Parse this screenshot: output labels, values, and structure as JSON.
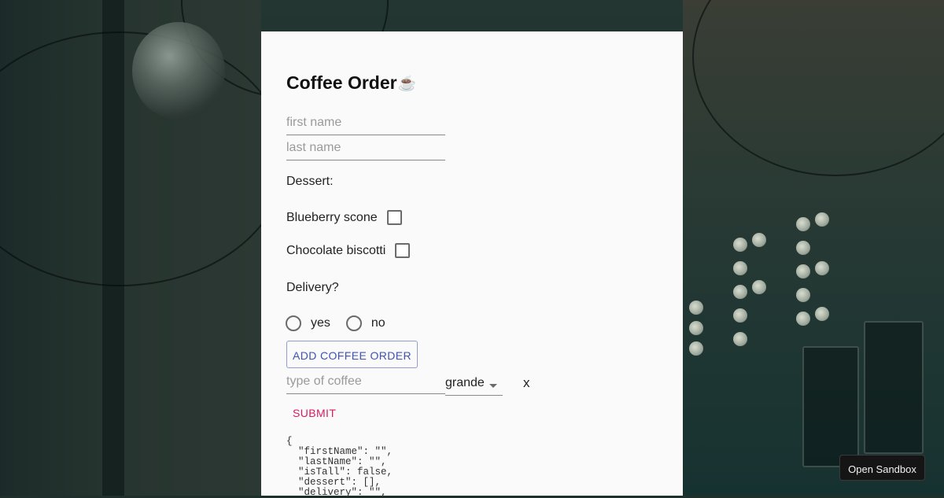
{
  "form": {
    "title": "Coffee Order",
    "title_emoji": "☕",
    "first_name_placeholder": "first name",
    "last_name_placeholder": "last name",
    "dessert_label": "Dessert:",
    "desserts": [
      {
        "label": "Blueberry scone",
        "checked": false
      },
      {
        "label": "Chocolate biscotti",
        "checked": false
      }
    ],
    "delivery_label": "Delivery?",
    "delivery_options": [
      {
        "label": "yes",
        "selected": false
      },
      {
        "label": "no",
        "selected": false
      }
    ],
    "add_button_label": "ADD COFFEE ORDER",
    "coffee_type_placeholder": "type of coffee",
    "size_value": "grande",
    "remove_label": "x",
    "submit_label": "SUBMIT",
    "json_preview": "{\n  \"firstName\": \"\",\n  \"lastName\": \"\",\n  \"isTall\": false,\n  \"dessert\": [],\n  \"delivery\": \"\","
  },
  "sandbox_button_label": "Open Sandbox",
  "colors": {
    "card_bg": "#fafafa",
    "primary": "#3f51b5",
    "secondary": "#d81b60",
    "sandbox_bg": "#151515"
  }
}
